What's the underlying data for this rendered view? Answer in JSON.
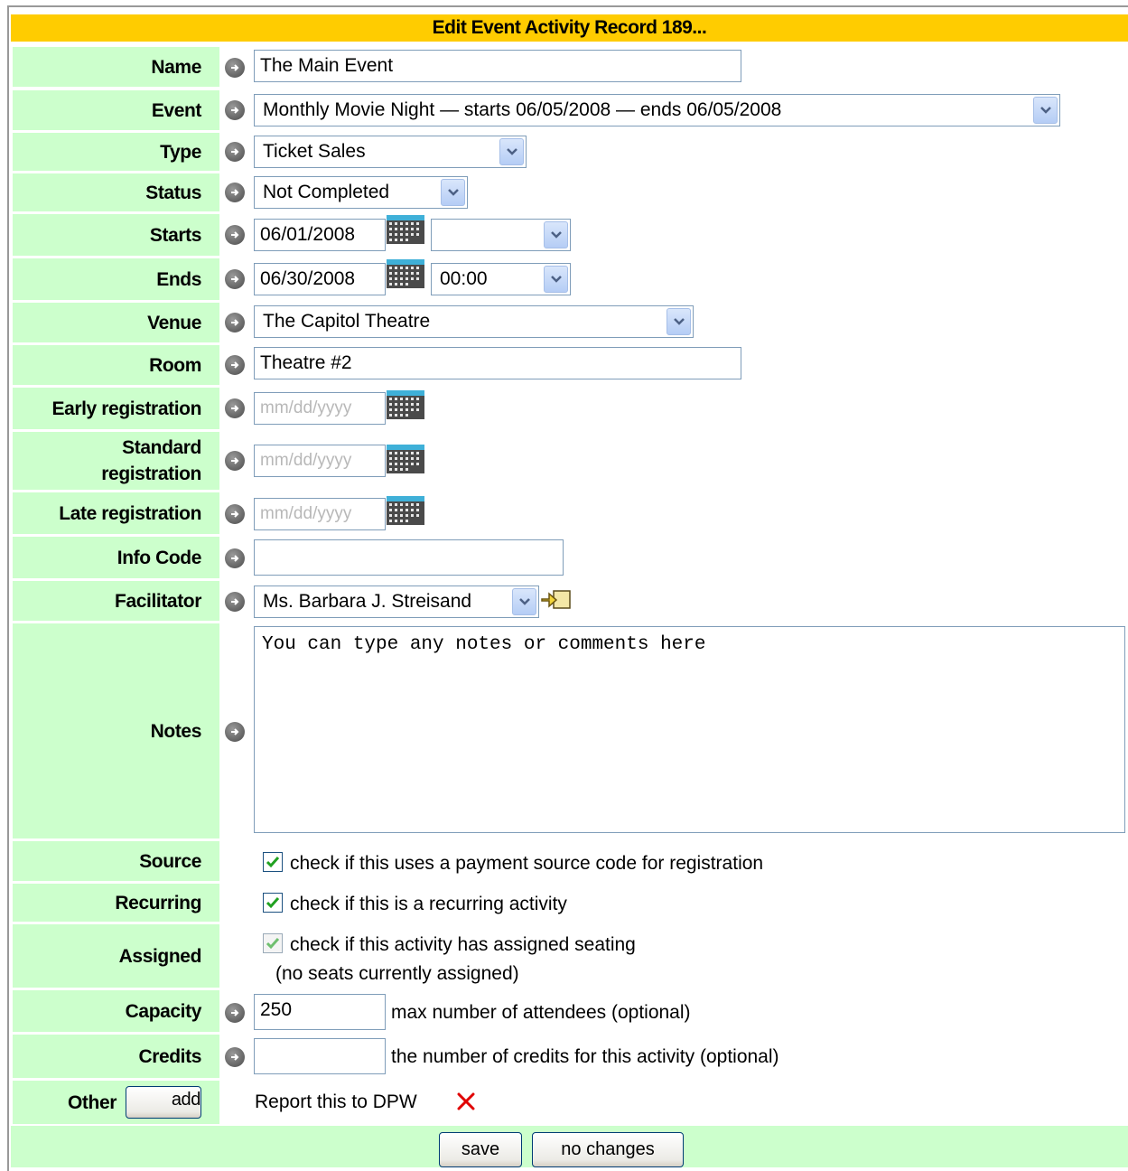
{
  "form": {
    "title": "Edit Event Activity Record 189...",
    "labels": {
      "name": "Name",
      "event": "Event",
      "type": "Type",
      "status": "Status",
      "starts": "Starts",
      "ends": "Ends",
      "venue": "Venue",
      "room": "Room",
      "early_registration": "Early registration",
      "standard_registration_1": "Standard",
      "standard_registration_2": "registration",
      "late_registration": "Late registration",
      "info_code": "Info Code",
      "facilitator": "Facilitator",
      "notes": "Notes",
      "source": "Source",
      "recurring": "Recurring",
      "assigned": "Assigned",
      "capacity": "Capacity",
      "credits": "Credits",
      "other": "Other"
    },
    "values": {
      "name": "The Main Event",
      "event": "Monthly Movie Night — starts 06/05/2008 — ends 06/05/2008",
      "type": "Ticket Sales",
      "status": "Not Completed",
      "starts_date": "06/01/2008",
      "starts_time": "",
      "ends_date": "06/30/2008",
      "ends_time": "00:00",
      "venue": "The Capitol Theatre",
      "room": "Theatre #2",
      "early_registration": "",
      "standard_registration": "",
      "late_registration": "",
      "info_code": "",
      "facilitator": "Ms. Barbara J. Streisand",
      "notes": "You can type any notes or comments here",
      "capacity": "250",
      "credits": ""
    },
    "placeholders": {
      "date": "mm/dd/yyyy"
    },
    "checkboxes": {
      "source": {
        "checked": true,
        "text": "check if this uses a payment source code for registration"
      },
      "recurring": {
        "checked": true,
        "text": "check if this is a recurring activity"
      },
      "assigned": {
        "checked": true,
        "text": "check if this activity has assigned seating",
        "note": "(no seats currently assigned)"
      }
    },
    "hints": {
      "capacity": "max number of attendees (optional)",
      "credits": "the number of credits for this activity (optional)"
    },
    "other": {
      "add_label": "add",
      "item": "Report this to DPW"
    },
    "buttons": {
      "save": "save",
      "no_changes": "no changes"
    }
  },
  "colors": {
    "title_bar": "#ffcc00",
    "label_bg": "#ccffcc",
    "remove_x": "#e00000"
  },
  "icons": [
    "arrow-right-icon",
    "calendar-icon",
    "chevron-down-icon",
    "lookup-icon",
    "remove-icon",
    "checkmark-icon"
  ]
}
